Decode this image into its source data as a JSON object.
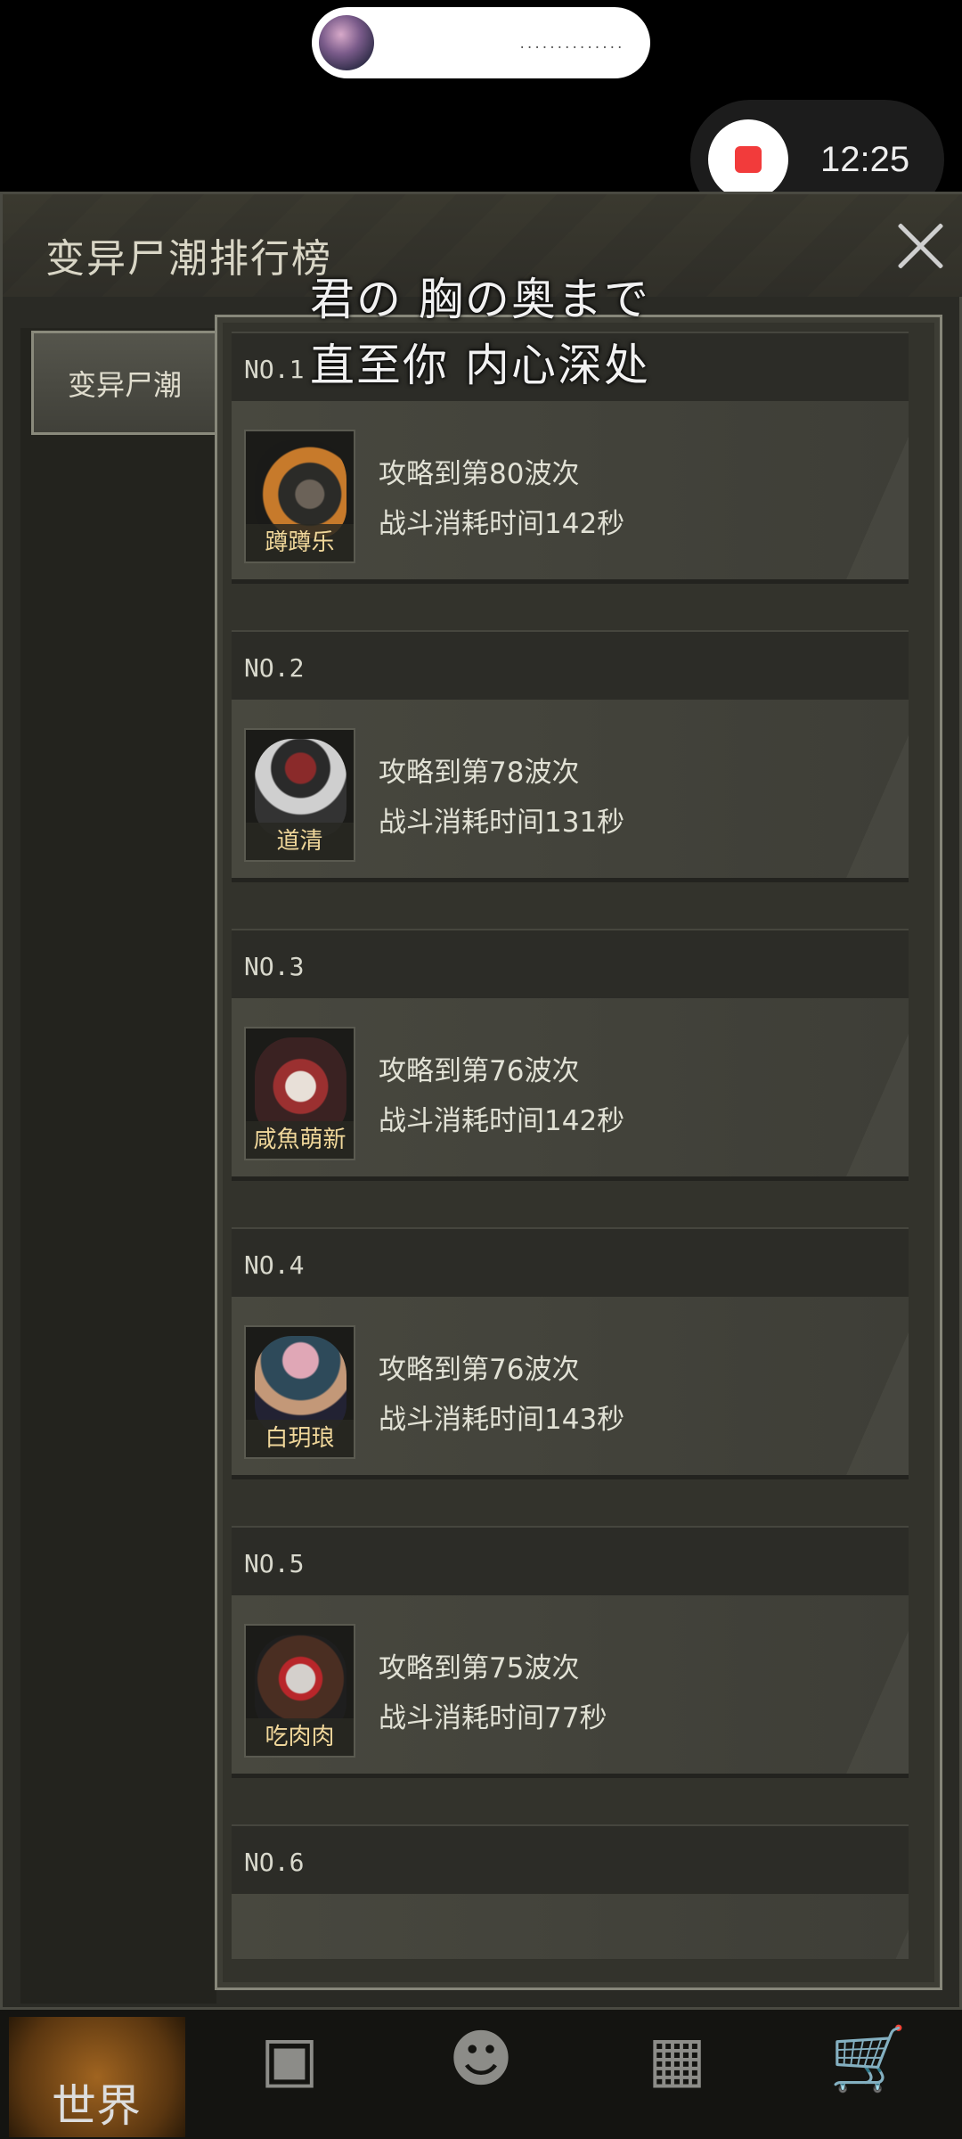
{
  "status": {
    "time": "12:25",
    "island_dots": "··············"
  },
  "window": {
    "title": "变异尸潮排行榜",
    "close_icon": "close-icon"
  },
  "tabs": [
    {
      "label": "变异尸潮"
    }
  ],
  "overlay": {
    "line1": "君の 胸の奥まで",
    "line2": "直至你 内心深处"
  },
  "entries": [
    {
      "rank": "NO.1",
      "name": "蹲蹲乐",
      "progress": "攻略到第80波次",
      "time": "战斗消耗时间142秒"
    },
    {
      "rank": "NO.2",
      "name": "道清",
      "progress": "攻略到第78波次",
      "time": "战斗消耗时间131秒"
    },
    {
      "rank": "NO.3",
      "name": "咸魚萌新",
      "progress": "攻略到第76波次",
      "time": "战斗消耗时间142秒"
    },
    {
      "rank": "NO.4",
      "name": "白玥琅",
      "progress": "攻略到第76波次",
      "time": "战斗消耗时间143秒"
    },
    {
      "rank": "NO.5",
      "name": "吃肉肉",
      "progress": "攻略到第75波次",
      "time": "战斗消耗时间77秒"
    },
    {
      "rank": "NO.6",
      "name": "",
      "progress": "",
      "time": ""
    }
  ],
  "bottom_nav": {
    "world_label": "世界"
  },
  "colors": {
    "record_dot": "#f23b3b",
    "name_text": "#f0d79a"
  }
}
